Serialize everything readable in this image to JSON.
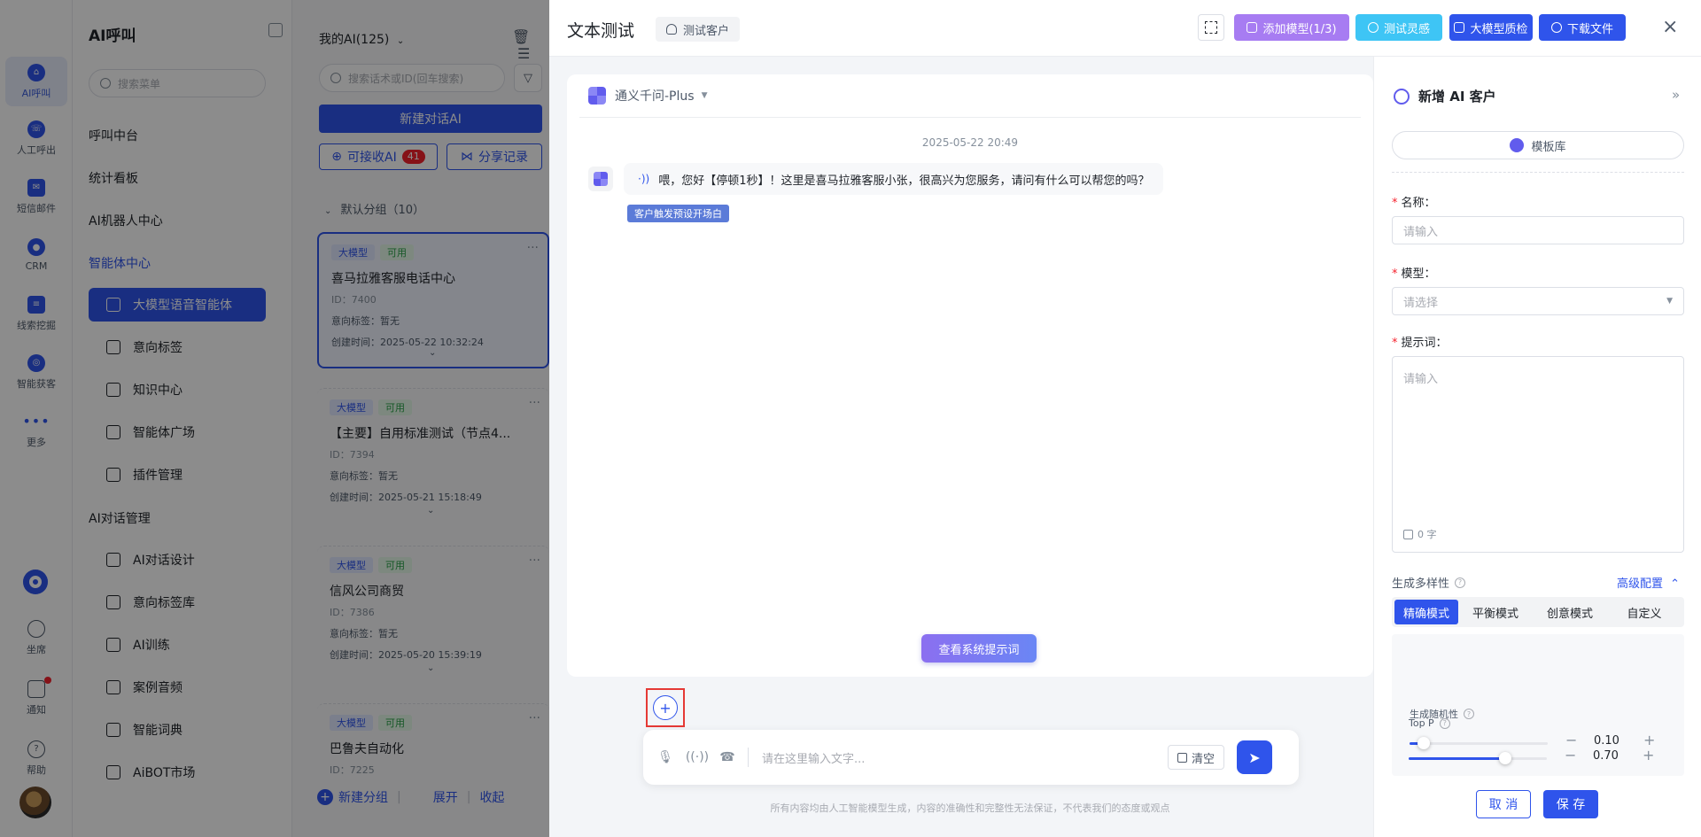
{
  "rail": {
    "items": [
      {
        "label": "AI呼叫"
      },
      {
        "label": "人工呼出"
      },
      {
        "label": "短信邮件"
      },
      {
        "label": "CRM"
      },
      {
        "label": "线索挖掘"
      },
      {
        "label": "智能获客"
      },
      {
        "label": "更多"
      }
    ],
    "bottom": [
      {
        "label": "坐席"
      },
      {
        "label": "通知"
      },
      {
        "label": "帮助"
      }
    ]
  },
  "sidebar": {
    "title": "AI呼叫",
    "search_placeholder": "搜索菜单",
    "top_items": [
      "呼叫中台",
      "统计看板",
      "AI机器人中心"
    ],
    "group_agent": "智能体中心",
    "agent_items": [
      "大模型语音智能体",
      "意向标签",
      "知识中心",
      "智能体广场",
      "插件管理"
    ],
    "group_dialog": "AI对话管理",
    "dialog_items": [
      "AI对话设计",
      "意向标签库",
      "AI训练",
      "案例音频",
      "智能词典",
      "AiBOT市场"
    ]
  },
  "ailist": {
    "header": "我的AI(125)",
    "search_placeholder": "搜索话术或ID(回车搜索)",
    "new_button": "新建对话AI",
    "receivable_label": "可接收AI",
    "receivable_count": "41",
    "share_label": "分享记录",
    "group_label": "默认分组（10）",
    "card_labels": {
      "intent": "意向标签：",
      "created": "创建时间："
    },
    "cards": [
      {
        "tag1": "大模型",
        "tag2": "可用",
        "title": "喜马拉雅客服电话中心",
        "id": "ID：7400",
        "intent": "暂无",
        "created": "2025-05-22 10:32:24"
      },
      {
        "tag1": "大模型",
        "tag2": "可用",
        "title": "【主要】自用标准测试（节点4...",
        "id": "ID：7394",
        "intent": "暂无",
        "created": "2025-05-21 15:18:49"
      },
      {
        "tag1": "大模型",
        "tag2": "可用",
        "title": "信风公司商贸",
        "id": "ID：7386",
        "intent": "暂无",
        "created": "2025-05-20 15:39:19"
      },
      {
        "tag1": "大模型",
        "tag2": "可用",
        "title": "巴鲁夫自动化",
        "id": "ID：7225"
      }
    ],
    "footer": {
      "new_group": "新建分组",
      "expand": "展开",
      "collapse": "收起"
    }
  },
  "drawer": {
    "title": "文本测试",
    "customer_chip": "测试客户",
    "buttons": {
      "add_model": "添加模型(1/3)",
      "inspiration": "测试灵感",
      "quality": "大模型质检",
      "download": "下载文件"
    },
    "close": "×",
    "chat": {
      "model_name": "通义千问-Plus",
      "timestamp": "2025-05-22 20:49",
      "bot_message": "喂，您好【停顿1秒】！这里是喜马拉雅客服小张，很高兴为您服务，请问有什么可以帮您的吗？",
      "trigger_tag": "客户触发预设开场白",
      "system_prompt_button": "查看系统提示词"
    },
    "input": {
      "placeholder": "请在这里输入文字...",
      "clear": "清空"
    },
    "disclaimer": "所有内容均由人工智能模型生成，内容的准确性和完整性无法保证，不代表我们的态度或观点"
  },
  "config": {
    "title": "新增 AI 客户",
    "template_button": "模板库",
    "name_label": "名称：",
    "name_placeholder": "请输入",
    "model_label": "模型：",
    "model_placeholder": "请选择",
    "prompt_label": "提示词：",
    "prompt_placeholder": "请输入",
    "char_count": "0 字",
    "diversity_label": "生成多样性",
    "advanced": "高级配置",
    "modes": [
      "精确模式",
      "平衡模式",
      "创意模式",
      "自定义"
    ],
    "active_mode": "精确模式",
    "randomness_label": "生成随机性",
    "randomness_value": "0.10",
    "randomness_fraction": 0.1,
    "topp_label": "Top P",
    "topp_value": "0.70",
    "topp_fraction": 0.7,
    "cancel": "取 消",
    "save": "保 存"
  },
  "colors": {
    "primary": "#2f54eb",
    "purple": "#a77cf2",
    "cyan": "#3ec5f5",
    "mask": "rgba(0,0,0,0.45)"
  }
}
